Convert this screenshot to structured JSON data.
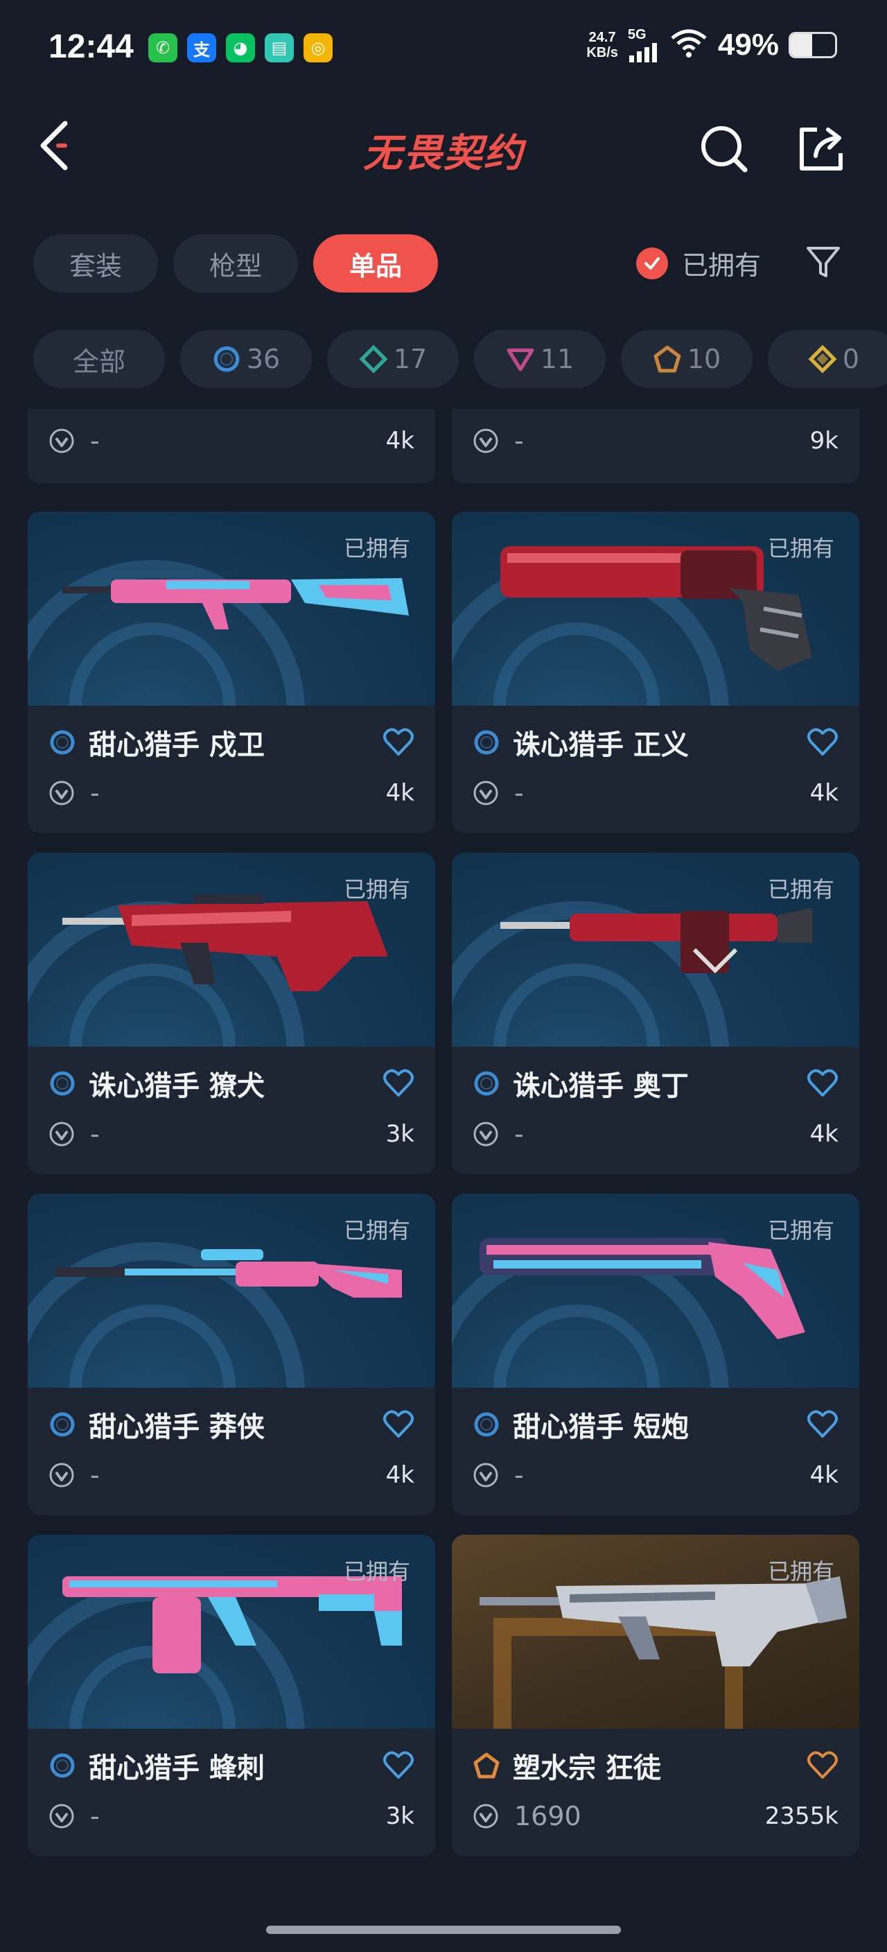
{
  "status_bar": {
    "time": "12:44",
    "net_speed_value": "24.7",
    "net_speed_unit": "KB/s",
    "network_type": "5G",
    "battery_percent": "49%",
    "battery_level": 0.49,
    "apps": [
      {
        "name": "phone-app-icon",
        "color": "#27c24c",
        "glyph": "✆"
      },
      {
        "name": "alipay-app-icon",
        "color": "#1677ff",
        "glyph": "支"
      },
      {
        "name": "wechat-app-icon",
        "color": "#07c160",
        "glyph": "◕"
      },
      {
        "name": "card-app-icon",
        "color": "#30c8b4",
        "glyph": "▤"
      },
      {
        "name": "coin-app-icon",
        "color": "#f5b400",
        "glyph": "◎"
      }
    ]
  },
  "header": {
    "title": "无畏契约",
    "title_color": "#f0524c"
  },
  "category_tabs": [
    {
      "label": "套装",
      "active": false
    },
    {
      "label": "枪型",
      "active": false
    },
    {
      "label": "单品",
      "active": true
    }
  ],
  "owned_filter": {
    "label": "已拥有",
    "checked": true
  },
  "tier_chips": [
    {
      "label": "全部",
      "count": "",
      "icon": "none"
    },
    {
      "label": "",
      "count": "36",
      "icon": "select-tier-icon",
      "color": "#3d8bd0"
    },
    {
      "label": "",
      "count": "17",
      "icon": "deluxe-tier-icon",
      "color": "#2fa89a"
    },
    {
      "label": "",
      "count": "11",
      "icon": "premium-tier-icon",
      "color": "#c04a8c"
    },
    {
      "label": "",
      "count": "10",
      "icon": "exclusive-tier-icon",
      "color": "#c9863f"
    },
    {
      "label": "",
      "count": "0",
      "icon": "ultra-tier-icon",
      "color": "#d8b13c"
    }
  ],
  "partial_cards": [
    {
      "price": "-",
      "count": "4k"
    },
    {
      "price": "-",
      "count": "9k"
    }
  ],
  "cards": [
    {
      "name": "甜心猎手 戍卫",
      "owned_label": "已拥有",
      "price": "-",
      "count": "4k",
      "tier": "select",
      "tier_color": "#3d8bd0",
      "heart_color": "#4a9fe0",
      "bg": "blue",
      "weapon": "rifle-pink"
    },
    {
      "name": "诛心猎手 正义",
      "owned_label": "已拥有",
      "price": "-",
      "count": "4k",
      "tier": "select",
      "tier_color": "#3d8bd0",
      "heart_color": "#4a9fe0",
      "bg": "blue",
      "weapon": "revolver-red"
    },
    {
      "name": "诛心猎手 獠犬",
      "owned_label": "已拥有",
      "price": "-",
      "count": "3k",
      "tier": "select",
      "tier_color": "#3d8bd0",
      "heart_color": "#4a9fe0",
      "bg": "blue",
      "weapon": "bullpup-red"
    },
    {
      "name": "诛心猎手 奥丁",
      "owned_label": "已拥有",
      "price": "-",
      "count": "4k",
      "tier": "select",
      "tier_color": "#3d8bd0",
      "heart_color": "#4a9fe0",
      "bg": "blue",
      "weapon": "lmg-red"
    },
    {
      "name": "甜心猎手 莽侠",
      "owned_label": "已拥有",
      "price": "-",
      "count": "4k",
      "tier": "select",
      "tier_color": "#3d8bd0",
      "heart_color": "#4a9fe0",
      "bg": "blue",
      "weapon": "sniper-pink"
    },
    {
      "name": "甜心猎手 短炮",
      "owned_label": "已拥有",
      "price": "-",
      "count": "4k",
      "tier": "select",
      "tier_color": "#3d8bd0",
      "heart_color": "#4a9fe0",
      "bg": "blue",
      "weapon": "shorty-pink"
    },
    {
      "name": "甜心猎手 蜂刺",
      "owned_label": "已拥有",
      "price": "-",
      "count": "3k",
      "tier": "select",
      "tier_color": "#3d8bd0",
      "heart_color": "#4a9fe0",
      "bg": "blue",
      "weapon": "smg-pink"
    },
    {
      "name": "塑水宗 狂徒",
      "owned_label": "已拥有",
      "price": "1690",
      "count": "2355k",
      "tier": "exclusive",
      "tier_color": "#e08a3c",
      "heart_color": "#e08a3c",
      "bg": "gold",
      "weapon": "rifle-silver"
    }
  ]
}
